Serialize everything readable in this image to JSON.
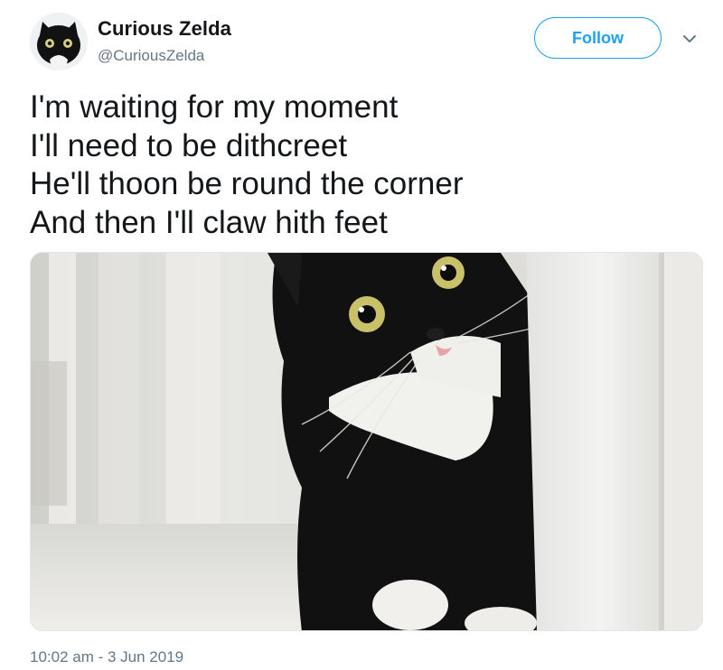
{
  "tweet": {
    "display_name": "Curious Zelda",
    "handle": "@CuriousZelda",
    "follow_label": "Follow",
    "text_lines": [
      "I'm waiting for my moment",
      "I'll need to be dithcreet",
      "He'll thoon be round the corner",
      "And then I'll claw hith feet"
    ],
    "timestamp": "10:02 am - 3 Jun 2019"
  },
  "icons": {
    "menu": "chevron-down-icon"
  },
  "colors": {
    "accent": "#1da1f2",
    "secondary_text": "#657786",
    "primary_text": "#14171a"
  }
}
